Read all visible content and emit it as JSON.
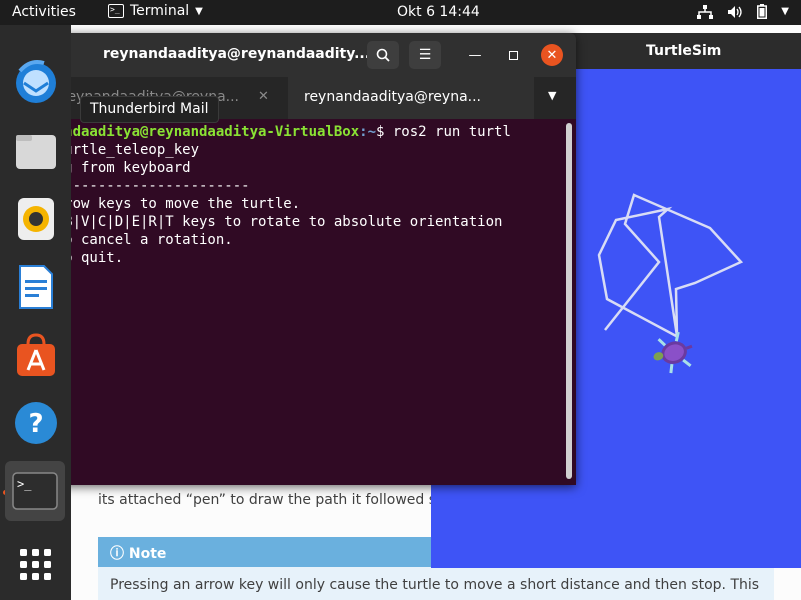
{
  "topbar": {
    "activities": "Activities",
    "app_name": "Terminal",
    "clock": "Okt 6  14:44"
  },
  "dock": {
    "tooltip": "Thunderbird Mail",
    "items": [
      "Thunderbird Mail",
      "Files",
      "Rhythmbox",
      "LibreOffice Writer",
      "Ubuntu Software",
      "Help",
      "Terminal",
      "Show Applications"
    ]
  },
  "background_page": {
    "paragraph": "its attached “pen” to draw the path it followed s",
    "note_title": "Note",
    "note_text": "Pressing an arrow key will only cause the turtle to move a short distance and then stop. This"
  },
  "turtlesim": {
    "title": "TurtleSim",
    "background": "#3e54f6"
  },
  "terminal": {
    "window_title": "reynandaaditya@reynandaadity...",
    "tabs": [
      {
        "label": "reynandaaditya@reyna...",
        "active": false
      },
      {
        "label": "reynandaaditya@reyna...",
        "active": true
      }
    ],
    "prompt_user": "reynandaaditya@reynandaaditya-VirtualBox",
    "prompt_path": ":~",
    "command": "$ ros2 run turtl",
    "lines": [
      "sim turtle_teleop_key",
      "eading from keyboard",
      "---------------------------",
      "se arrow keys to move the turtle.",
      "se G|B|V|C|D|E|R|T keys to rotate to absolute orientation",
      "'F' to cancel a rotation.",
      "'Q' to quit."
    ]
  }
}
